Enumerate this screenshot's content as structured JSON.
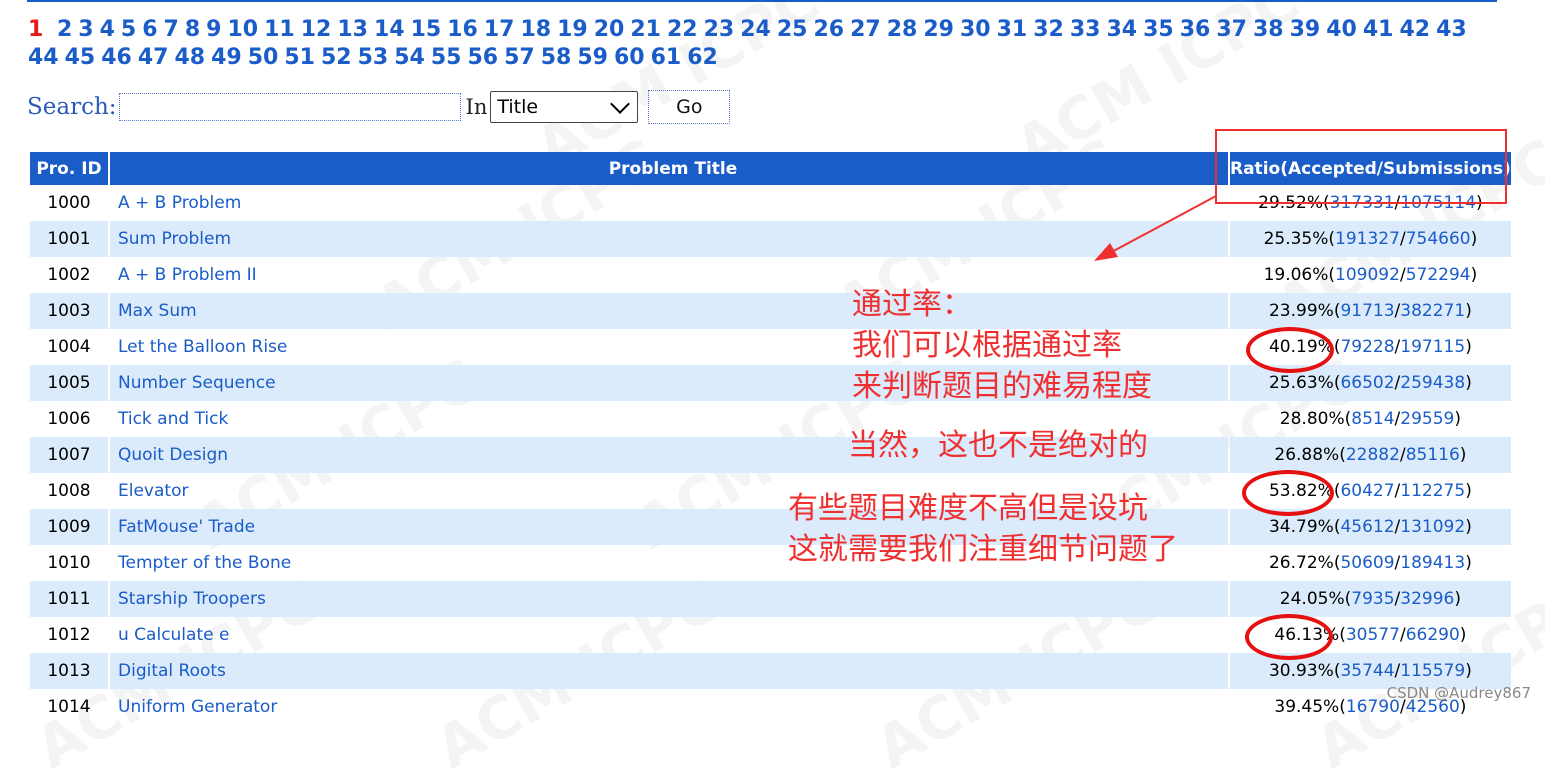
{
  "pager": {
    "current": "1",
    "pages": [
      "2",
      "3",
      "4",
      "5",
      "6",
      "7",
      "8",
      "9",
      "10",
      "11",
      "12",
      "13",
      "14",
      "15",
      "16",
      "17",
      "18",
      "19",
      "20",
      "21",
      "22",
      "23",
      "24",
      "25",
      "26",
      "27",
      "28",
      "29",
      "30",
      "31",
      "32",
      "33",
      "34",
      "35",
      "36",
      "37",
      "38",
      "39",
      "40",
      "41",
      "42",
      "43",
      "44",
      "45",
      "46",
      "47",
      "48",
      "49",
      "50",
      "51",
      "52",
      "53",
      "54",
      "55",
      "56",
      "57",
      "58",
      "59",
      "60",
      "61",
      "62"
    ]
  },
  "search": {
    "label": "Search:",
    "value": "",
    "in_label": "In",
    "select_value": "Title",
    "go_label": "Go"
  },
  "table": {
    "headers": [
      "Pro. ID",
      "Problem Title",
      "Ratio(Accepted/Submissions)"
    ],
    "rows": [
      {
        "id": "1000",
        "title": "A + B Problem",
        "pct": "29.52%",
        "accepted": "317331",
        "submissions": "1075114"
      },
      {
        "id": "1001",
        "title": "Sum Problem",
        "pct": "25.35%",
        "accepted": "191327",
        "submissions": "754660"
      },
      {
        "id": "1002",
        "title": "A + B Problem II",
        "pct": "19.06%",
        "accepted": "109092",
        "submissions": "572294"
      },
      {
        "id": "1003",
        "title": "Max Sum",
        "pct": "23.99%",
        "accepted": "91713",
        "submissions": "382271"
      },
      {
        "id": "1004",
        "title": "Let the Balloon Rise",
        "pct": "40.19%",
        "accepted": "79228",
        "submissions": "197115"
      },
      {
        "id": "1005",
        "title": "Number Sequence",
        "pct": "25.63%",
        "accepted": "66502",
        "submissions": "259438"
      },
      {
        "id": "1006",
        "title": "Tick and Tick",
        "pct": "28.80%",
        "accepted": "8514",
        "submissions": "29559"
      },
      {
        "id": "1007",
        "title": "Quoit Design",
        "pct": "26.88%",
        "accepted": "22882",
        "submissions": "85116"
      },
      {
        "id": "1008",
        "title": "Elevator",
        "pct": "53.82%",
        "accepted": "60427",
        "submissions": "112275"
      },
      {
        "id": "1009",
        "title": "FatMouse' Trade",
        "pct": "34.79%",
        "accepted": "45612",
        "submissions": "131092"
      },
      {
        "id": "1010",
        "title": "Tempter of the Bone",
        "pct": "26.72%",
        "accepted": "50609",
        "submissions": "189413"
      },
      {
        "id": "1011",
        "title": "Starship Troopers",
        "pct": "24.05%",
        "accepted": "7935",
        "submissions": "32996"
      },
      {
        "id": "1012",
        "title": "u Calculate e",
        "pct": "46.13%",
        "accepted": "30577",
        "submissions": "66290"
      },
      {
        "id": "1013",
        "title": "Digital Roots",
        "pct": "30.93%",
        "accepted": "35744",
        "submissions": "115579"
      },
      {
        "id": "1014",
        "title": "Uniform Generator",
        "pct": "39.45%",
        "accepted": "16790",
        "submissions": "42560"
      }
    ]
  },
  "watermark": "ACM ICPC",
  "annotations": {
    "line1": "通过率：",
    "line2": "我们可以根据通过率",
    "line3": "来判断题目的难易程度",
    "line4": "当然，这也不是绝对的",
    "line5": "有些题目难度不高但是设坑",
    "line6": "这就需要我们注重细节问题了",
    "color": "#f03030"
  },
  "credit": "CSDN @Audrey867"
}
